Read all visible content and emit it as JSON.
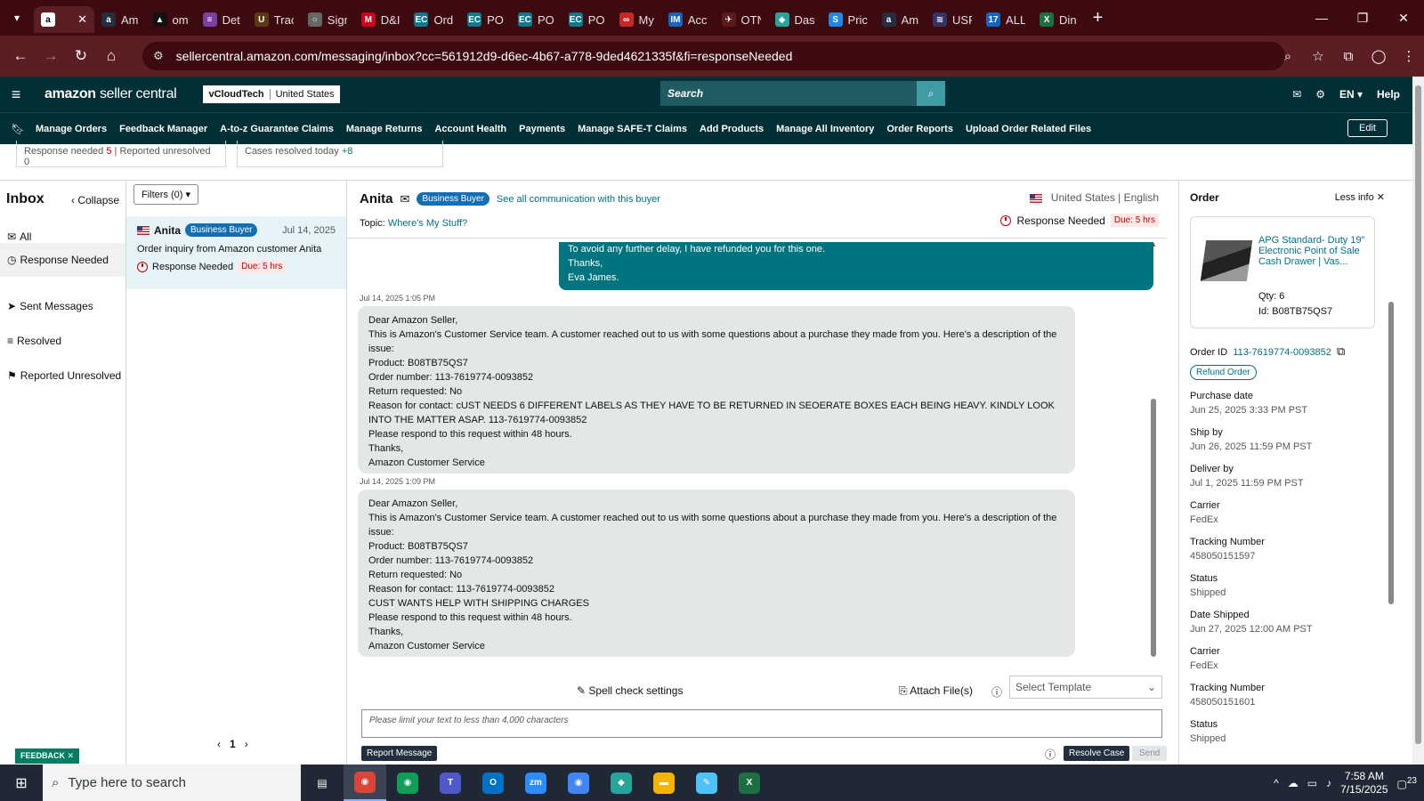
{
  "browser": {
    "tabs": [
      {
        "title": "Am",
        "color": "#232f3e",
        "glyph": "a"
      },
      {
        "title": "om",
        "color": "#111111",
        "glyph": "▲"
      },
      {
        "title": "Det",
        "color": "#7a3fa0",
        "glyph": "≡"
      },
      {
        "title": "Trac",
        "color": "#5a3a14",
        "glyph": "U"
      },
      {
        "title": "Sign",
        "color": "#666666",
        "glyph": "○"
      },
      {
        "title": "D&I",
        "color": "#d0021b",
        "glyph": "M"
      },
      {
        "title": "Ord",
        "color": "#0b7a8c",
        "glyph": "EC"
      },
      {
        "title": "PO",
        "color": "#0b7a8c",
        "glyph": "EC"
      },
      {
        "title": "PO",
        "color": "#0b7a8c",
        "glyph": "EC"
      },
      {
        "title": "PO",
        "color": "#0b7a8c",
        "glyph": "EC"
      },
      {
        "title": "My",
        "color": "#c62828",
        "glyph": "∞"
      },
      {
        "title": "Acc",
        "color": "#1565c0",
        "glyph": "IM"
      },
      {
        "title": "OTN",
        "color": "#5d1a1a",
        "glyph": "✈"
      },
      {
        "title": "Das",
        "color": "#26a69a",
        "glyph": "◆"
      },
      {
        "title": "Pric",
        "color": "#1e88e5",
        "glyph": "S"
      },
      {
        "title": "Am",
        "color": "#232f3e",
        "glyph": "a"
      },
      {
        "title": "USP",
        "color": "#333366",
        "glyph": "≋"
      },
      {
        "title": "ALL",
        "color": "#1565c0",
        "glyph": "17"
      },
      {
        "title": "Din",
        "color": "#1d6f42",
        "glyph": "X"
      }
    ],
    "active_tab_glyph": "a",
    "url": "sellercentral.amazon.com/messaging/inbox?cc=561912d9-d6ec-4b67-a778-9ded4621335f&fi=responseNeeded"
  },
  "header": {
    "logo_main": "amazon",
    "logo_sub": "seller central",
    "account": "vCloudTech",
    "marketplace": "United States",
    "search_placeholder": "Search",
    "lang": "EN",
    "help": "Help"
  },
  "nav": {
    "items": [
      "Manage Orders",
      "Feedback Manager",
      "A-to-z Guarantee Claims",
      "Manage Returns",
      "Account Health",
      "Payments",
      "Manage SAFE-T Claims",
      "Add Products",
      "Manage All Inventory",
      "Order Reports",
      "Upload Order Related Files"
    ],
    "edit": "Edit"
  },
  "stats": {
    "response_needed_label": "Response needed",
    "response_needed": "5",
    "reported_unresolved_label": "Reported unresolved",
    "reported_unresolved": "0",
    "cases_resolved_label": "Cases resolved today",
    "cases_resolved": "+8"
  },
  "sidebar": {
    "title": "Inbox",
    "collapse": "Collapse",
    "items": [
      {
        "label": "All",
        "icon": "✉"
      },
      {
        "label": "Response Needed",
        "icon": "◷"
      },
      {
        "label": "Sent Messages",
        "icon": "➤"
      },
      {
        "label": "Resolved",
        "icon": "≡"
      },
      {
        "label": "Reported Unresolved",
        "icon": "⚑"
      }
    ]
  },
  "conversations": {
    "filters": "Filters (0)",
    "items": [
      {
        "name": "Anita",
        "badge": "Business Buyer",
        "date": "Jul 14, 2025",
        "subject": "Order inquiry from Amazon customer Anita",
        "status": "Response Needed",
        "due": "Due: 5 hrs"
      }
    ],
    "page": "1"
  },
  "thread": {
    "buyer": "Anita",
    "badge": "Business Buyer",
    "see_all": "See all communication with this buyer",
    "country": "United States",
    "language": "English",
    "topic_label": "Topic:",
    "topic": "Where's My Stuff?",
    "status": "Response Needed",
    "due": "Due: 5 hrs",
    "outgoing_lines": [
      "To avoid any further delay, I have refunded you for this one.",
      "Thanks,",
      "Eva James."
    ],
    "messages": [
      {
        "time": "Jul 14, 2025 1:05 PM",
        "lines": [
          "Dear Amazon Seller,",
          "This is Amazon's Customer Service team. A customer reached out to us with some questions about a purchase they made from you. Here's a description of the issue:",
          "Product: B08TB75QS7",
          "Order number: 113-7619774-0093852",
          "Return requested: No",
          "Reason for contact: cUST NEEDS 6 DIFFERENT LABELS AS THEY HAVE TO BE RETURNED IN SEOERATE BOXES EACH BEING HEAVY. KINDLY LOOK INTO THE MATTER ASAP. 113-7619774-0093852",
          "Please respond to this request within 48 hours.",
          "Thanks,",
          "Amazon Customer Service"
        ]
      },
      {
        "time": "Jul 14, 2025 1:09 PM",
        "lines": [
          "Dear Amazon Seller,",
          "This is Amazon's Customer Service team. A customer reached out to us with some questions about a purchase they made from you. Here's a description of the issue:",
          "Product: B08TB75QS7",
          "Order number: 113-7619774-0093852",
          "Return requested: No",
          "Reason for contact: 113-7619774-0093852",
          "CUST WANTS HELP WITH SHIPPING CHARGES",
          "Please respond to this request within 48 hours.",
          "Thanks,",
          "Amazon Customer Service"
        ]
      }
    ]
  },
  "compose": {
    "spell": "Spell check settings",
    "attach": "Attach File(s)",
    "template_placeholder": "Select Template",
    "text_placeholder": "Please limit your text to less than 4,000 characters",
    "report": "Report Message",
    "resolve": "Resolve Case",
    "send": "Send"
  },
  "order": {
    "title": "Order",
    "less_info": "Less info",
    "product_title": "APG Standard- Duty 19\" Electronic Point of Sale Cash Drawer | Vas...",
    "qty": "Qty: 6",
    "asin": "Id: B08TB75QS7",
    "order_id_label": "Order ID",
    "order_id": "113-7619774-0093852",
    "refund": "Refund Order",
    "fields": [
      {
        "label": "Purchase date",
        "value": "Jun 25, 2025 3:33 PM PST"
      },
      {
        "label": "Ship by",
        "value": "Jun 26, 2025 11:59 PM PST"
      },
      {
        "label": "Deliver by",
        "value": "Jul 1, 2025 11:59 PM PST"
      },
      {
        "label": "Carrier",
        "value": "FedEx"
      },
      {
        "label": "Tracking Number",
        "value": "458050151597"
      },
      {
        "label": "Status",
        "value": "Shipped"
      },
      {
        "label": "Date Shipped",
        "value": "Jun 27, 2025 12:00 AM PST"
      },
      {
        "label": "Carrier",
        "value": "FedEx"
      },
      {
        "label": "Tracking Number",
        "value": "458050151601"
      },
      {
        "label": "Status",
        "value": "Shipped"
      }
    ]
  },
  "feedback": "FEEDBACK",
  "taskbar": {
    "search": "Type here to search",
    "apps": [
      {
        "name": "chrome",
        "color": "#db4437",
        "glyph": "◉"
      },
      {
        "name": "chrome",
        "color": "#0f9d58",
        "glyph": "◉"
      },
      {
        "name": "teams",
        "color": "#5059c9",
        "glyph": "T"
      },
      {
        "name": "outlook",
        "color": "#0072c6",
        "glyph": "O"
      },
      {
        "name": "zoom",
        "color": "#2d8cff",
        "glyph": "zm"
      },
      {
        "name": "chrome",
        "color": "#4285f4",
        "glyph": "◉"
      },
      {
        "name": "app",
        "color": "#26a69a",
        "glyph": "◆"
      },
      {
        "name": "explorer",
        "color": "#f4b400",
        "glyph": "▬"
      },
      {
        "name": "notes",
        "color": "#4fc3f7",
        "glyph": "✎"
      },
      {
        "name": "excel",
        "color": "#1d6f42",
        "glyph": "X"
      }
    ],
    "time": "7:58 AM",
    "date": "7/15/2025",
    "notif": "23"
  }
}
